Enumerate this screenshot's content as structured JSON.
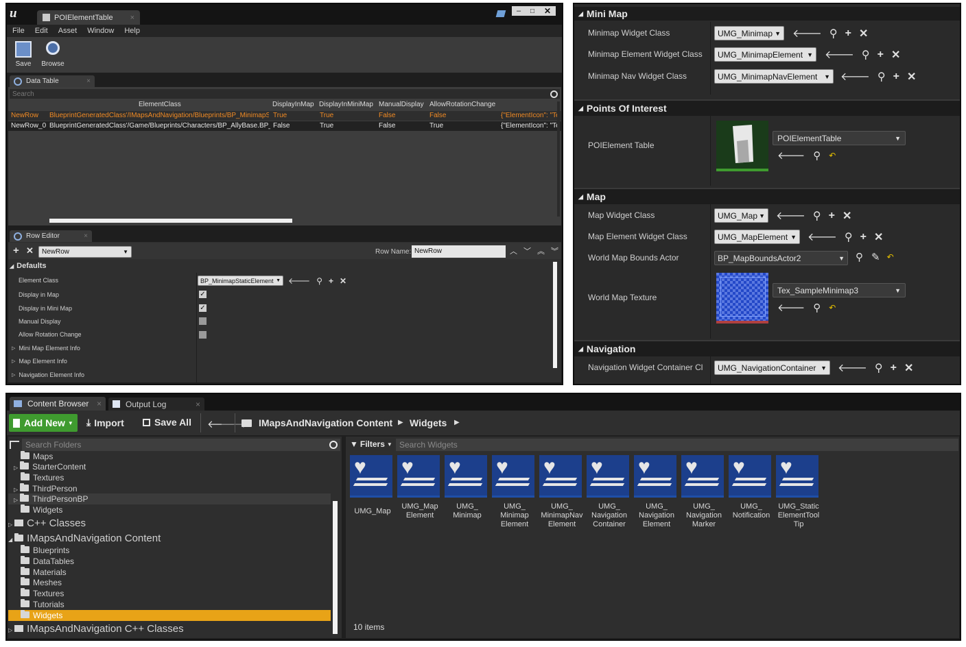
{
  "dt": {
    "tab_title": "POIElementTable",
    "menu": [
      "File",
      "Edit",
      "Asset",
      "Window",
      "Help"
    ],
    "toolbar": {
      "save": "Save",
      "browse": "Browse"
    },
    "data_table_tab": "Data Table",
    "search_placeholder": "Search",
    "columns": [
      "ElementClass",
      "DisplayInMap",
      "DisplayInMiniMap",
      "ManualDisplay",
      "AllowRotationChange"
    ],
    "rows": [
      {
        "name": "NewRow",
        "class": "BlueprintGeneratedClass'/IMapsAndNavigation/Blueprints/BP_MinimapS",
        "dim": "True",
        "dimm": "True",
        "md": "False",
        "arc": "False",
        "extra": "{\"ElementIcon\": \"Te"
      },
      {
        "name": "NewRow_0",
        "class": "BlueprintGeneratedClass'/Game/Blueprints/Characters/BP_AllyBase.BP_",
        "dim": "False",
        "dimm": "True",
        "md": "False",
        "arc": "True",
        "extra": "{\"ElementIcon\": \"Te"
      }
    ],
    "row_editor_tab": "Row Editor",
    "row_select": "NewRow",
    "row_name_label": "Row Name:",
    "row_name_value": "NewRow",
    "defaults": "Defaults",
    "props": {
      "element_class": "Element Class",
      "element_class_value": "BP_MinimapStaticElement",
      "display_in_map": "Display in Map",
      "display_in_mini_map": "Display in Mini Map",
      "manual_display": "Manual Display",
      "allow_rotation": "Allow Rotation Change",
      "mini_map_info": "Mini Map Element Info",
      "map_element_info": "Map Element Info",
      "nav_element_info": "Navigation Element Info"
    }
  },
  "details": {
    "minimap_header": "Mini Map",
    "minimap_widget_label": "Minimap Widget Class",
    "minimap_widget_value": "UMG_Minimap",
    "minimap_element_label": "Minimap Element Widget Class",
    "minimap_element_value": "UMG_MinimapElement",
    "minimap_nav_label": "Minimap Nav Widget Class",
    "minimap_nav_value": "UMG_MinimapNavElement",
    "poi_header": "Points Of Interest",
    "poi_label": "POIElement Table",
    "poi_value": "POIElementTable",
    "map_header": "Map",
    "map_widget_label": "Map Widget Class",
    "map_widget_value": "UMG_Map",
    "map_element_label": "Map Element Widget Class",
    "map_element_value": "UMG_MapElement",
    "bounds_label": "World Map Bounds Actor",
    "bounds_value": "BP_MapBoundsActor2",
    "texture_label": "World Map Texture",
    "texture_value": "Tex_SampleMinimap3",
    "nav_header": "Navigation",
    "nav_label": "Navigation Widget Container Cl",
    "nav_value": "UMG_NavigationContainer"
  },
  "cb": {
    "tab_content": "Content Browser",
    "tab_output": "Output Log",
    "add_new": "Add New",
    "import": "Import",
    "save_all": "Save All",
    "path": [
      "IMapsAndNavigation Content",
      "Widgets"
    ],
    "search_folders": "Search Folders",
    "filters": "Filters",
    "search_widgets": "Search Widgets",
    "tree": {
      "maps": "Maps",
      "starter": "StarterContent",
      "textures": "Textures",
      "thirdperson": "ThirdPerson",
      "thirdpersonbp": "ThirdPersonBP",
      "widgets": "Widgets",
      "cpp": "C++ Classes",
      "imaps": "IMapsAndNavigation Content",
      "blueprints": "Blueprints",
      "datatables": "DataTables",
      "materials": "Materials",
      "meshes": "Meshes",
      "textures2": "Textures",
      "tutorials": "Tutorials",
      "widgets2": "Widgets",
      "imaps_cpp": "IMapsAndNavigation C++ Classes"
    },
    "assets": [
      "UMG_Map",
      "UMG_Map\nElement",
      "UMG_\nMinimap",
      "UMG_\nMinimap\nElement",
      "UMG_\nMinimapNav\nElement",
      "UMG_\nNavigation\nContainer",
      "UMG_\nNavigation\nElement",
      "UMG_\nNavigation\nMarker",
      "UMG_\nNotification",
      "UMG_Static\nElementTool\nTip"
    ],
    "count": "10 items"
  },
  "colors": {
    "accent": "#e8a317",
    "green": "#3f9b2f",
    "highlight_text": "#f08a24",
    "asset_blue": "#1f4fa8"
  }
}
